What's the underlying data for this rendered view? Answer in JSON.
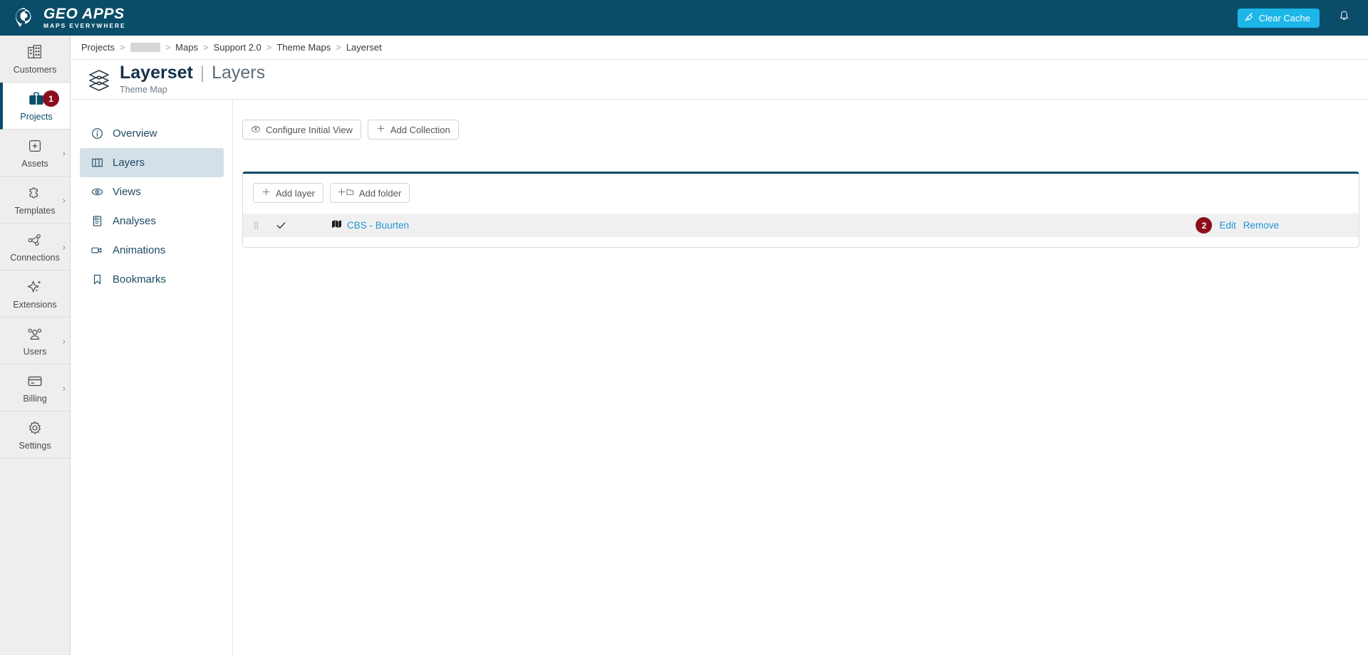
{
  "topbar": {
    "brand_name": "GEO APPS",
    "brand_tagline": "MAPS EVERYWHERE",
    "logo_icon": "map-pin-logo-icon",
    "clear_cache_label": "Clear Cache",
    "clear_cache_icon": "broom-icon",
    "clear_cache_color": "#1cb7e8",
    "notifications_icon": "bell-icon",
    "background_color": "#0a4d68"
  },
  "rail": {
    "items": [
      {
        "label": "Customers",
        "icon": "buildings-icon",
        "active": false,
        "has_chevron": false,
        "badge": null
      },
      {
        "label": "Projects",
        "icon": "briefcase-icon",
        "active": true,
        "has_chevron": false,
        "badge": "1"
      },
      {
        "label": "Assets",
        "icon": "plus-square-icon",
        "active": false,
        "has_chevron": true,
        "badge": null
      },
      {
        "label": "Templates",
        "icon": "puzzle-piece-icon",
        "active": false,
        "has_chevron": true,
        "badge": null
      },
      {
        "label": "Connections",
        "icon": "nodes-graph-icon",
        "active": false,
        "has_chevron": true,
        "badge": null
      },
      {
        "label": "Extensions",
        "icon": "sparkle-icon",
        "active": false,
        "has_chevron": false,
        "badge": null
      },
      {
        "label": "Users",
        "icon": "users-icon",
        "active": false,
        "has_chevron": true,
        "badge": null
      },
      {
        "label": "Billing",
        "icon": "credit-card-icon",
        "active": false,
        "has_chevron": true,
        "badge": null
      },
      {
        "label": "Settings",
        "icon": "gear-icon",
        "active": false,
        "has_chevron": false,
        "badge": null
      }
    ],
    "badge_color": "#8b0d1e"
  },
  "breadcrumb": {
    "separator": ">",
    "items": [
      {
        "label": "Projects",
        "redacted": false
      },
      {
        "label": "",
        "redacted": true
      },
      {
        "label": "Maps",
        "redacted": false
      },
      {
        "label": "Support 2.0",
        "redacted": false
      },
      {
        "label": "Theme Maps",
        "redacted": false
      },
      {
        "label": "Layerset",
        "redacted": false
      }
    ]
  },
  "page_header": {
    "icon": "layers-stack-icon",
    "title": "Layerset",
    "divider": "|",
    "subtitle": "Layers",
    "caption": "Theme Map"
  },
  "subnav": {
    "items": [
      {
        "label": "Overview",
        "icon": "info-circle-icon",
        "active": false
      },
      {
        "label": "Layers",
        "icon": "layers-map-icon",
        "active": true
      },
      {
        "label": "Views",
        "icon": "eye-icon",
        "active": false
      },
      {
        "label": "Analyses",
        "icon": "report-icon",
        "active": false
      },
      {
        "label": "Animations",
        "icon": "video-camera-icon",
        "active": false
      },
      {
        "label": "Bookmarks",
        "icon": "bookmark-icon",
        "active": false
      }
    ],
    "active_background": "#d4e0e8"
  },
  "toolbar": {
    "configure_initial_view_label": "Configure Initial View",
    "configure_initial_view_icon": "globe-view-icon",
    "add_collection_label": "Add Collection",
    "add_collection_icon": "plus-icon"
  },
  "layer_card": {
    "accent_color": "#0a4d68",
    "add_layer_label": "Add layer",
    "add_layer_icon": "plus-icon",
    "add_folder_label": "Add folder",
    "add_folder_icon": "folder-plus-icon",
    "rows": [
      {
        "drag_handle_icon": "drag-dots-icon",
        "visible_icon": "check-icon",
        "layer_icon": "map-icon",
        "name": "CBS - Buurten",
        "badge": "2",
        "edit_label": "Edit",
        "remove_label": "Remove",
        "link_color": "#2196d6"
      }
    ]
  }
}
